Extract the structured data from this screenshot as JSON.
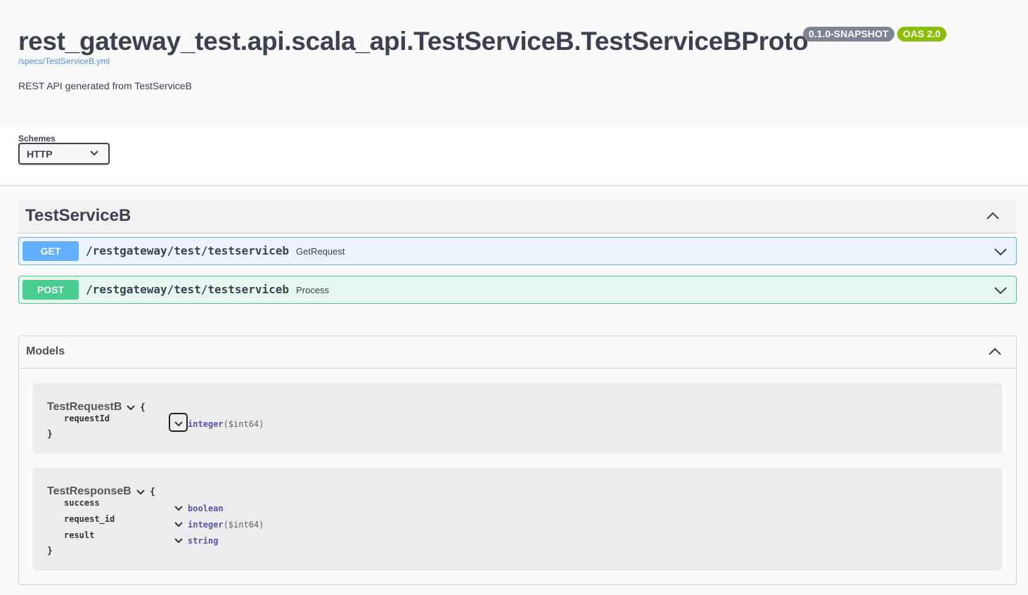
{
  "info": {
    "title": "rest_gateway_test.api.scala_api.TestServiceB.TestServiceBProto",
    "version_badge": "0.1.0-SNAPSHOT",
    "oas_badge": "OAS 2.0",
    "spec_link": "/specs/TestServiceB.yml",
    "description": "REST API generated from TestServiceB"
  },
  "schemes": {
    "label": "Schemes",
    "selected": "HTTP"
  },
  "tag": {
    "name": "TestServiceB",
    "toggle_icon": "chevron-up-icon"
  },
  "operations": [
    {
      "method": "GET",
      "path": "/restgateway/test/testserviceb",
      "summary": "GetRequest",
      "color": "#61affe"
    },
    {
      "method": "POST",
      "path": "/restgateway/test/testserviceb",
      "summary": "Process",
      "color": "#49cc90"
    }
  ],
  "models": {
    "title": "Models",
    "items": [
      {
        "name": "TestRequestB",
        "open_brace": "{",
        "close_brace": "}",
        "properties": [
          {
            "name": "requestId",
            "type": "integer",
            "format": "($int64)"
          }
        ]
      },
      {
        "name": "TestResponseB",
        "open_brace": "{",
        "close_brace": "}",
        "properties": [
          {
            "name": "success",
            "type": "boolean",
            "format": ""
          },
          {
            "name": "request_id",
            "type": "integer",
            "format": "($int64)"
          },
          {
            "name": "result",
            "type": "string",
            "format": ""
          }
        ]
      }
    ]
  },
  "colors": {
    "get": "#61affe",
    "post": "#49cc90",
    "version_badge": "#7d8492",
    "oas_badge": "#89bf04",
    "link": "#4990e2"
  }
}
